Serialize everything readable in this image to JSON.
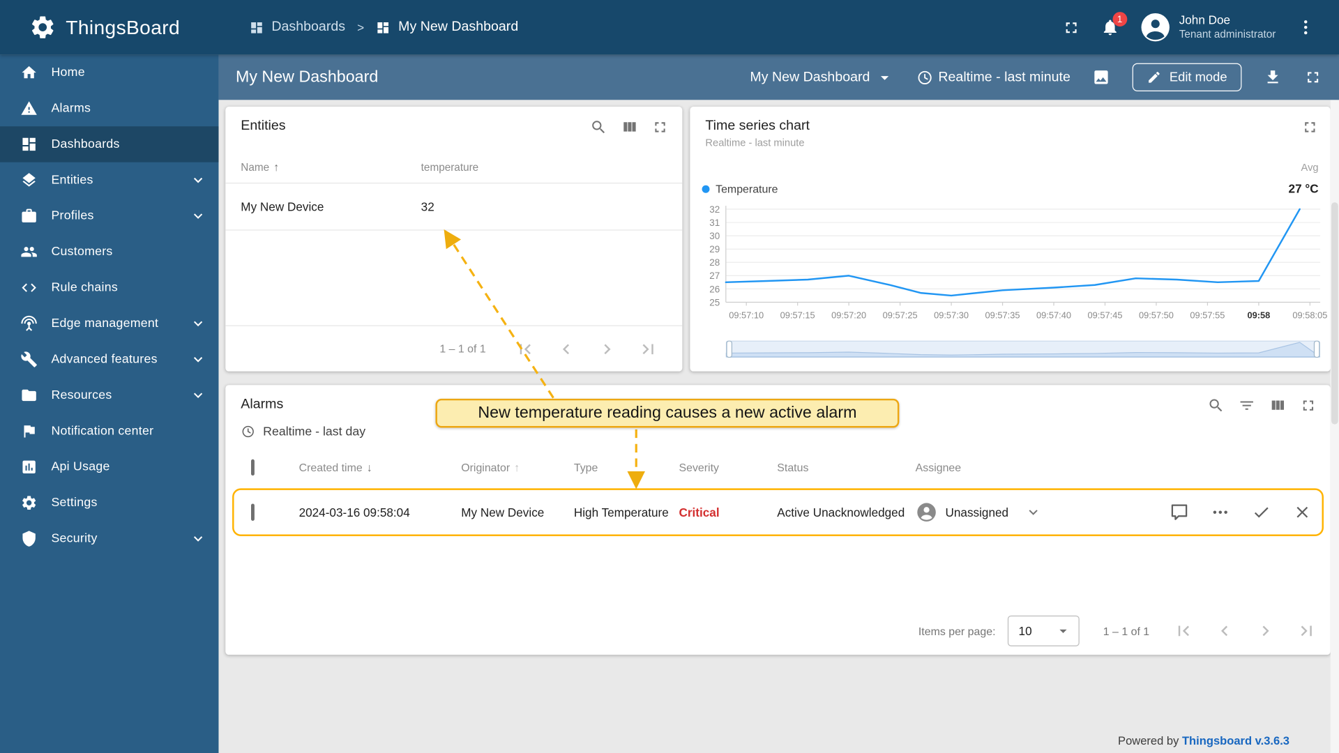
{
  "app": {
    "name": "ThingsBoard",
    "powered_by": "Powered by",
    "version_link": "Thingsboard v.3.6.3"
  },
  "colors": {
    "header": "#17486b",
    "sidebar": "#2a5e86",
    "toolbar": "#4a7193",
    "chart_line": "#2196f3",
    "critical": "#d32f2f",
    "highlight_border": "#ffb300",
    "annotation_border": "#eda712",
    "link": "#1867c0"
  },
  "icons": {
    "sort_asc": "↑",
    "sort_desc": "↓"
  },
  "header": {
    "separator": ">",
    "breadcrumb": [
      {
        "label": "Dashboards"
      },
      {
        "label": "My New Dashboard"
      }
    ],
    "notification_count": "1",
    "user": {
      "name": "John Doe",
      "role": "Tenant administrator"
    }
  },
  "sidebar": {
    "items": [
      {
        "label": "Home"
      },
      {
        "label": "Alarms"
      },
      {
        "label": "Dashboards",
        "active": true
      },
      {
        "label": "Entities",
        "expandable": true
      },
      {
        "label": "Profiles",
        "expandable": true
      },
      {
        "label": "Customers"
      },
      {
        "label": "Rule chains"
      },
      {
        "label": "Edge management",
        "expandable": true
      },
      {
        "label": "Advanced features",
        "expandable": true
      },
      {
        "label": "Resources",
        "expandable": true
      },
      {
        "label": "Notification center"
      },
      {
        "label": "Api Usage"
      },
      {
        "label": "Settings"
      },
      {
        "label": "Security",
        "expandable": true
      }
    ]
  },
  "toolbar": {
    "title": "My New Dashboard",
    "dashboard_select": "My New Dashboard",
    "timewindow": "Realtime - last minute",
    "edit_button": "Edit mode"
  },
  "entities_widget": {
    "title": "Entities",
    "col_name": "Name",
    "col_value": "temperature",
    "row": {
      "name": "My New Device",
      "value": "32"
    },
    "pagination": "1 – 1 of 1"
  },
  "chart_widget": {
    "title": "Time series chart",
    "subtitle": "Realtime - last minute",
    "legend_label": "Temperature",
    "agg_header": "Avg",
    "agg_value": "27 °C"
  },
  "chart_data": {
    "type": "line",
    "title": "Time series chart",
    "ylim": [
      25,
      32
    ],
    "yticks": [
      25,
      26,
      27,
      28,
      29,
      30,
      31,
      32
    ],
    "xlim": [
      "09:57:08",
      "09:58:06"
    ],
    "xticks": [
      {
        "label": "09:57:10",
        "t": "09:57:10"
      },
      {
        "label": "09:57:15",
        "t": "09:57:15"
      },
      {
        "label": "09:57:20",
        "t": "09:57:20"
      },
      {
        "label": "09:57:25",
        "t": "09:57:25"
      },
      {
        "label": "09:57:30",
        "t": "09:57:30"
      },
      {
        "label": "09:57:35",
        "t": "09:57:35"
      },
      {
        "label": "09:57:40",
        "t": "09:57:40"
      },
      {
        "label": "09:57:45",
        "t": "09:57:45"
      },
      {
        "label": "09:57:50",
        "t": "09:57:50"
      },
      {
        "label": "09:57:55",
        "t": "09:57:55"
      },
      {
        "label": "09:58",
        "t": "09:58:00",
        "bold": true
      },
      {
        "label": "09:58:05",
        "t": "09:58:05"
      }
    ],
    "series": [
      {
        "name": "Temperature",
        "color": "#2196f3",
        "avg": "27 °C",
        "points": [
          [
            "09:57:08",
            26.5
          ],
          [
            "09:57:12",
            26.6
          ],
          [
            "09:57:16",
            26.7
          ],
          [
            "09:57:20",
            27.0
          ],
          [
            "09:57:24",
            26.3
          ],
          [
            "09:57:27",
            25.7
          ],
          [
            "09:57:30",
            25.5
          ],
          [
            "09:57:35",
            25.9
          ],
          [
            "09:57:40",
            26.1
          ],
          [
            "09:57:44",
            26.3
          ],
          [
            "09:57:48",
            26.8
          ],
          [
            "09:57:52",
            26.7
          ],
          [
            "09:57:56",
            26.5
          ],
          [
            "09:58:00",
            26.6
          ],
          [
            "09:58:04",
            32.0
          ]
        ]
      }
    ],
    "legend_position": "top",
    "grid": true
  },
  "alarms_widget": {
    "title": "Alarms",
    "subtitle": "Realtime - last day",
    "columns": [
      "Created time",
      "Originator",
      "Type",
      "Severity",
      "Status",
      "Assignee"
    ],
    "row": {
      "created_time": "2024-03-16 09:58:04",
      "originator": "My New Device",
      "type": "High Temperature",
      "severity": "Critical",
      "severity_color": "#d32f2f",
      "status": "Active Unacknowledged",
      "assignee": "Unassigned"
    },
    "items_per_page_label": "Items per page:",
    "items_per_page": "10",
    "pagination": "1 – 1 of 1"
  },
  "annotation": {
    "text": "New temperature reading causes a new active alarm"
  }
}
